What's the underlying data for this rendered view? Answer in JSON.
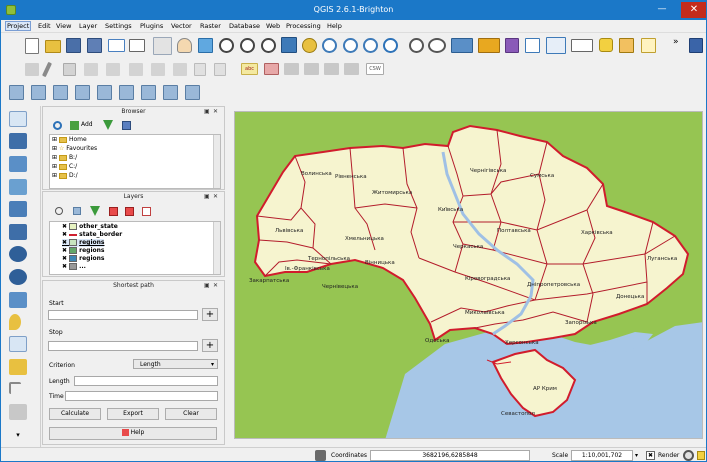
{
  "window": {
    "title": "QGIS 2.6.1-Brighton"
  },
  "menu": [
    "Project",
    "Edit",
    "View",
    "Layer",
    "Settings",
    "Plugins",
    "Vector",
    "Raster",
    "Database",
    "Web",
    "Processing",
    "Help"
  ],
  "toolbar": {
    "overflow": "»",
    "csw": "CSW",
    "abc": "abc"
  },
  "browser": {
    "title": "Browser",
    "add_label": "Add",
    "items": [
      "Home",
      "Favourites",
      "B:/",
      "C:/",
      "D:/"
    ]
  },
  "layers": {
    "title": "Layers",
    "items": [
      {
        "name": "other_state",
        "swatch": "#e7f3c2"
      },
      {
        "name": "state_border",
        "swatch": "#cf2030"
      },
      {
        "name": "regions",
        "swatch": "#c8e6c0"
      },
      {
        "name": "regions",
        "swatch": "#63a86b"
      },
      {
        "name": "regions",
        "swatch": "#3e87b5"
      },
      {
        "name": "...",
        "swatch": "#999999"
      }
    ]
  },
  "shortest_path": {
    "title": "Shortest path",
    "start_label": "Start",
    "stop_label": "Stop",
    "criterion_label": "Criterion",
    "criterion_value": "Length",
    "length_label": "Length",
    "time_label": "Time",
    "calculate_label": "Calculate",
    "export_label": "Export",
    "clear_label": "Clear",
    "help_label": "Help",
    "plus": "+"
  },
  "map": {
    "colors": {
      "land": "#f6f4cf",
      "neighbor": "#96c552",
      "sea": "#a7c7e7",
      "border": "#d11c2c",
      "region_border": "#b31c2b",
      "river": "#9fc0e5"
    },
    "labels": {
      "volyn": "Волинська",
      "rivne": "Рівненська",
      "zhytomyr": "Житомирська",
      "kyivska": "Київська",
      "chernihiv": "Чернігівська",
      "sumy": "Сумська",
      "lviv": "Львівська",
      "khmel": "Хмельницька",
      "ternopil": "Тернопільська",
      "poltava": "Полтавська",
      "kharkiv": "Харківська",
      "cherkasy": "Черкаська",
      "vinnytsia": "Вінницька",
      "ivano": "Ів.-Франківська",
      "zakarp": "Закарпатська",
      "chernivtsi": "Чернівецька",
      "kirovohrad": "Кіровоградська",
      "luhansk": "Луганська",
      "dnipro": "Дніпропетровська",
      "donetsk": "Донецька",
      "mykolaiv": "Миколаївська",
      "zaporizh": "Запорізька",
      "odesa": "Одеська",
      "kherson": "Херсонська",
      "crimea": "АР Крим",
      "sevastopol": "Севастопол"
    }
  },
  "status": {
    "coordinates_label": "Coordinates",
    "coordinates_value": "3682196,6285848",
    "scale_label": "Scale",
    "scale_value": "1:10,001,702",
    "render_label": "Render"
  }
}
